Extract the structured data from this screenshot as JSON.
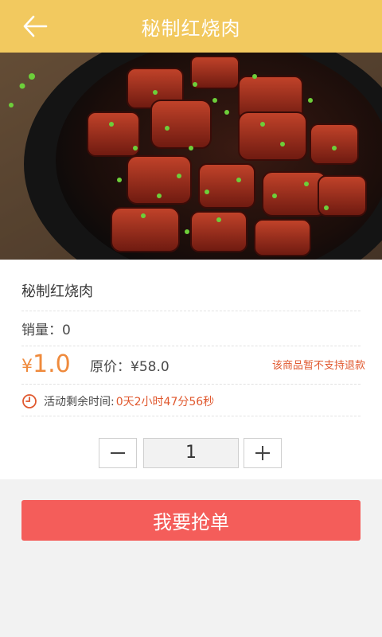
{
  "header": {
    "title": "秘制红烧肉",
    "back_icon": "arrow-left-icon"
  },
  "product": {
    "name": "秘制红烧肉",
    "sales_label": "销量：",
    "sales_value": "0",
    "price_symbol": "¥",
    "price": "1.0",
    "original_price_label": "原价：",
    "original_price": "¥58.0",
    "refund_notice": "该商品暂不支持退款",
    "timer_icon": "clock-icon",
    "timer_label": "活动剩余时间:",
    "timer_value": "0天2小时47分56秒"
  },
  "quantity": {
    "value": "1",
    "minus_icon": "minus-icon",
    "plus_icon": "plus-icon"
  },
  "actions": {
    "grab_label": "我要抢单"
  },
  "colors": {
    "header": "#f2c95f",
    "accent_price": "#ef8a3c",
    "accent_red": "#e0582e",
    "button": "#f45d5a"
  }
}
